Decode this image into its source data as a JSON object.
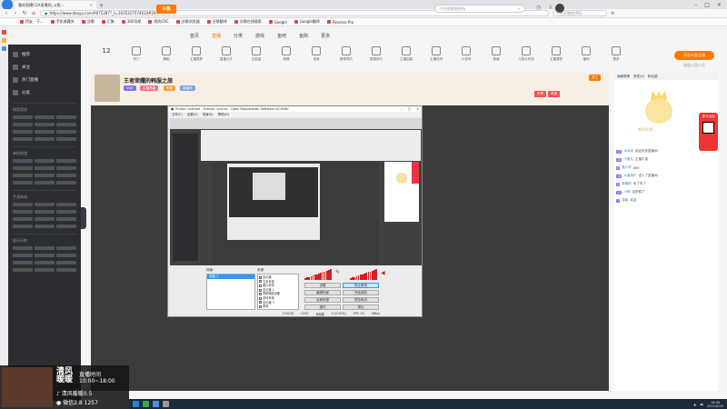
{
  "browser": {
    "tab_title": "骚欢直播CGX直播间_斗鱼...",
    "url": "https://www.douyu.com/9075287?_t=1635327574614#29...",
    "search_placeholder": "宁阿双胞胎拼场...",
    "bookmarks": [
      "用友 - 下...",
      "手机收藏夹",
      "谷歌",
      "汇聚",
      "360导航",
      "我的CBC",
      "谷歌浏览器",
      "谷歌翻译",
      "谷歌在线搜索",
      "Google",
      "Google翻译",
      "Resolve Pro"
    ]
  },
  "site": {
    "logo": "斗鱼",
    "nav": [
      "首页",
      "直播",
      "分类",
      "游戏",
      "鱼吧",
      "鱼购",
      "更多"
    ],
    "active_nav": 1,
    "search_placeholder": "宁阿双胞胎拼场",
    "categories": [
      "12",
      "热门",
      "舞蹈",
      "主播推荐",
      "直播大厅",
      "正能量",
      "竞猜",
      "电竞",
      "赛事预约",
      "数据排行",
      "主播招募",
      "主播时间",
      "小游戏",
      "鱼塘",
      "斗鱼大作战",
      "主播课堂",
      "福利",
      "更多"
    ],
    "promo": "开启斗鱼之旅",
    "promo_sub": "发起斗鱼小号"
  },
  "sidebar": {
    "items": [
      "推荐",
      "关注",
      "热门直播",
      "分类"
    ],
    "sections": [
      "网游竞技",
      "单机热游",
      "手游休闲",
      "娱乐天地"
    ]
  },
  "streamer": {
    "title": "王者荣耀的韩服之旅",
    "badges": [
      "CGX",
      "主播等级",
      "贵族",
      "直播间"
    ],
    "follow": "关注",
    "share": [
      "分享",
      "举报"
    ]
  },
  "obs": {
    "window_title": "Profile: Untitled - Scenes: scenes - Open Broadcaster Software v0.659b",
    "menu": [
      "文件(F)",
      "设置(S)",
      "场景(S)",
      "帮助(H)"
    ],
    "scenes_label": "场景：",
    "sources_label": "来源：",
    "scene_selected": "场景 1",
    "sources": [
      "显示器",
      "文本来源",
      "图片来源",
      "显示器 2",
      "视频捕捉设备",
      "游戏来源",
      "显示器 3",
      "其他"
    ],
    "buttons": [
      "设置",
      "停止串流",
      "编辑场景",
      "开始录制",
      "全局来源",
      "预览串流",
      "插件",
      "退出"
    ],
    "status": [
      "0:00:00",
      "LOST",
      "丢帧数",
      "0 (0.00%)",
      "FPS: 30",
      "4Mb/s"
    ]
  },
  "chat": {
    "top": [
      "贡献周榜",
      "贵宾(0)",
      "粉丝团"
    ],
    "art_text": "知乎大哥",
    "badge": "参与活动",
    "messages": [
      {
        "lv": "12",
        "name": "冰冰凉",
        "text": "欢迎来到直播间"
      },
      {
        "lv": "10",
        "name": "小鱼丸",
        "text": "主播牛逼"
      },
      {
        "lv": "8",
        "name": "路人甲",
        "text": "666"
      },
      {
        "lv": "14",
        "name": "斗鱼用户",
        "text": "进入了直播间"
      },
      {
        "lv": "9",
        "name": "奔跑吧",
        "text": "来了来了"
      },
      {
        "lv": "11",
        "name": "小明",
        "text": "这把稳了"
      },
      {
        "lv": "7",
        "name": "游客",
        "text": "欢迎"
      }
    ]
  },
  "overlay": {
    "name": "清风暖暖",
    "time_label": "直播时间",
    "time": "10:00~18:00",
    "douyin": "清风暖暖0.5",
    "wechat": "微信2.8 1257"
  },
  "taskbar": {
    "time": "18:08",
    "date": "2021/6/29"
  }
}
